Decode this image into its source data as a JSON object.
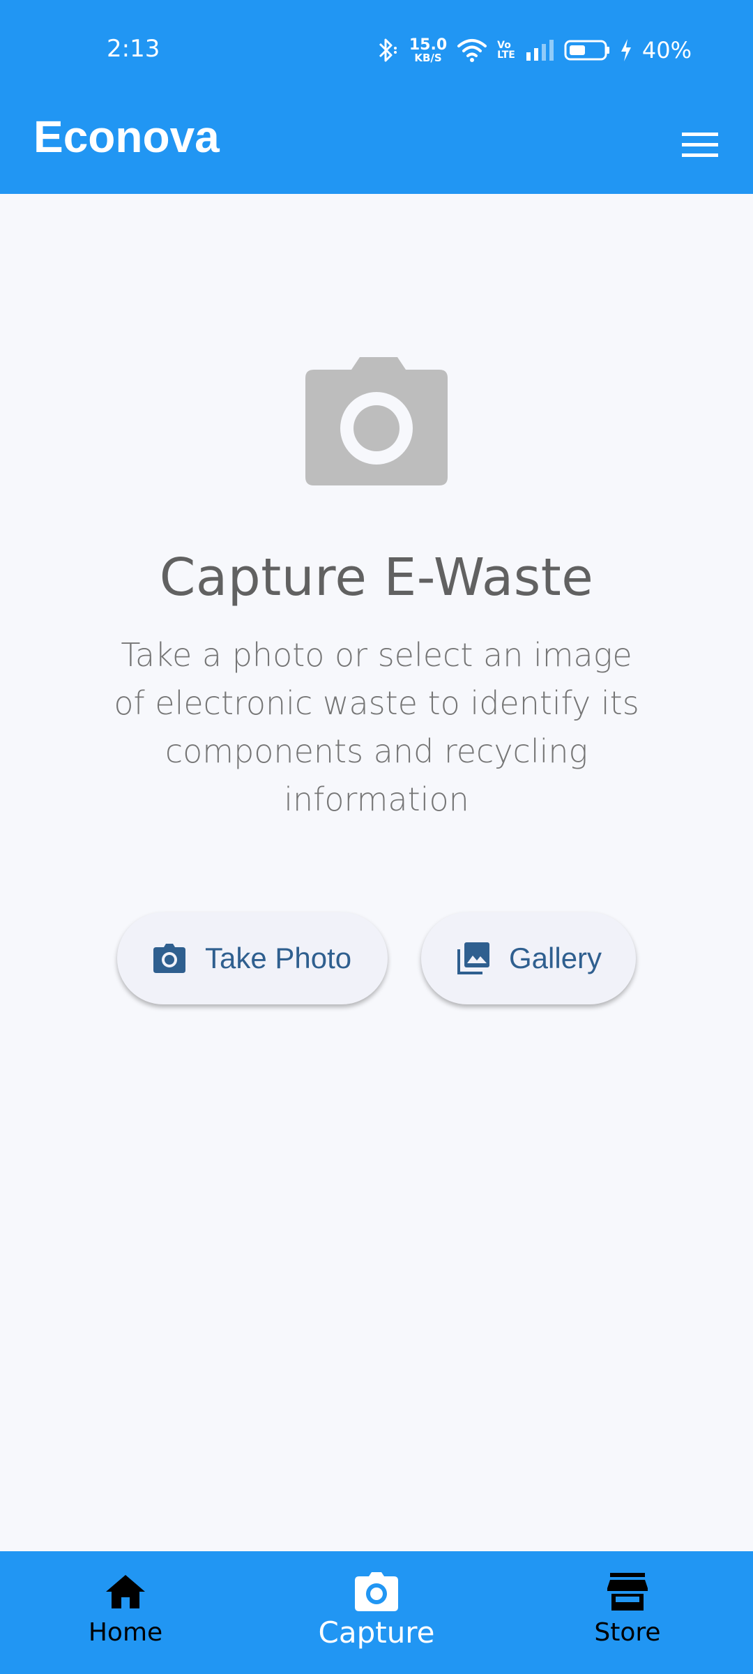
{
  "status_bar": {
    "time": "2:13",
    "net_speed_value": "15.0",
    "net_speed_unit": "KB/S",
    "volte_top": "Vo",
    "volte_bottom": "LTE",
    "battery_percent": "40%",
    "icons": [
      "bluetooth-icon",
      "wifi-icon",
      "signal-icon",
      "battery-icon",
      "charging-icon"
    ]
  },
  "app_bar": {
    "title": "Econova",
    "menu_icon": "hamburger-menu-icon"
  },
  "main": {
    "hero_icon": "camera-icon",
    "headline": "Capture E-Waste",
    "description": "Take a photo or select an image of electronic waste to identify its components and recycling information",
    "buttons": {
      "take_photo": "Take Photo",
      "gallery": "Gallery"
    }
  },
  "bottom_nav": {
    "items": [
      {
        "label": "Home",
        "icon": "home-icon"
      },
      {
        "label": "Capture",
        "icon": "camera-icon",
        "selected": true
      },
      {
        "label": "Store",
        "icon": "store-icon"
      }
    ]
  },
  "colors": {
    "primary": "#2196f3",
    "background": "#f7f8fc",
    "button_text": "#2f5f8f",
    "hero_icon": "#bdbdbd"
  }
}
